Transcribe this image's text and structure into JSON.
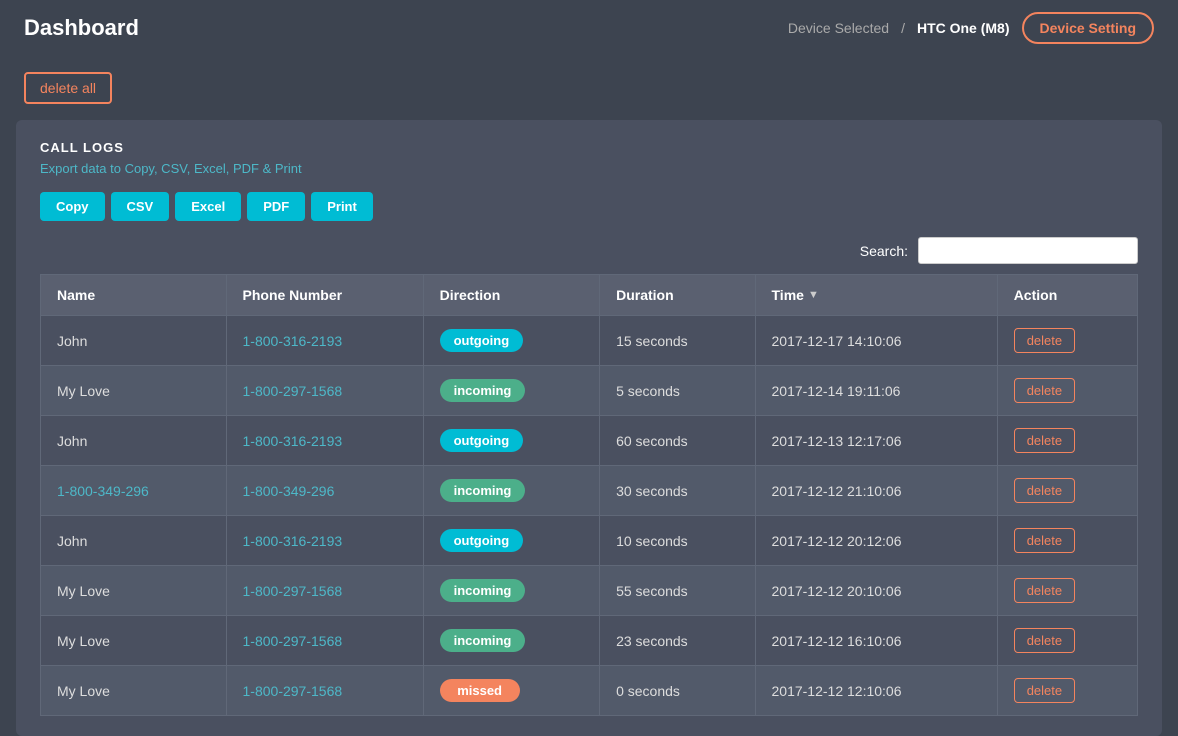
{
  "header": {
    "title": "Dashboard",
    "device_selected_label": "Device Selected",
    "separator": "/",
    "device_name": "HTC One (M8)",
    "device_setting_btn": "Device Setting"
  },
  "toolbar": {
    "delete_all_btn": "delete all"
  },
  "section": {
    "title": "CALL LOGS",
    "export_text_prefix": "Export data",
    "export_text_suffix": " to Copy, CSV, Excel, PDF & Print"
  },
  "export_buttons": [
    "Copy",
    "CSV",
    "Excel",
    "PDF",
    "Print"
  ],
  "search": {
    "label": "Search:",
    "placeholder": ""
  },
  "table": {
    "columns": [
      "Name",
      "Phone Number",
      "Direction",
      "Duration",
      "Time",
      "Action"
    ],
    "delete_btn_label": "delete",
    "rows": [
      {
        "name": "John",
        "name_is_link": false,
        "phone": "1-800-316-2193",
        "direction": "outgoing",
        "duration": "15 seconds",
        "time": "2017-12-17 14:10:06"
      },
      {
        "name": "My Love",
        "name_is_link": false,
        "phone": "1-800-297-1568",
        "direction": "incoming",
        "duration": "5 seconds",
        "time": "2017-12-14 19:11:06"
      },
      {
        "name": "John",
        "name_is_link": false,
        "phone": "1-800-316-2193",
        "direction": "outgoing",
        "duration": "60 seconds",
        "time": "2017-12-13 12:17:06"
      },
      {
        "name": "1-800-349-296",
        "name_is_link": true,
        "phone": "1-800-349-296",
        "direction": "incoming",
        "duration": "30 seconds",
        "time": "2017-12-12 21:10:06"
      },
      {
        "name": "John",
        "name_is_link": false,
        "phone": "1-800-316-2193",
        "direction": "outgoing",
        "duration": "10 seconds",
        "time": "2017-12-12 20:12:06"
      },
      {
        "name": "My Love",
        "name_is_link": false,
        "phone": "1-800-297-1568",
        "direction": "incoming",
        "duration": "55 seconds",
        "time": "2017-12-12 20:10:06"
      },
      {
        "name": "My Love",
        "name_is_link": false,
        "phone": "1-800-297-1568",
        "direction": "incoming",
        "duration": "23 seconds",
        "time": "2017-12-12 16:10:06"
      },
      {
        "name": "My Love",
        "name_is_link": false,
        "phone": "1-800-297-1568",
        "direction": "missed",
        "duration": "0 seconds",
        "time": "2017-12-12 12:10:06"
      }
    ]
  }
}
